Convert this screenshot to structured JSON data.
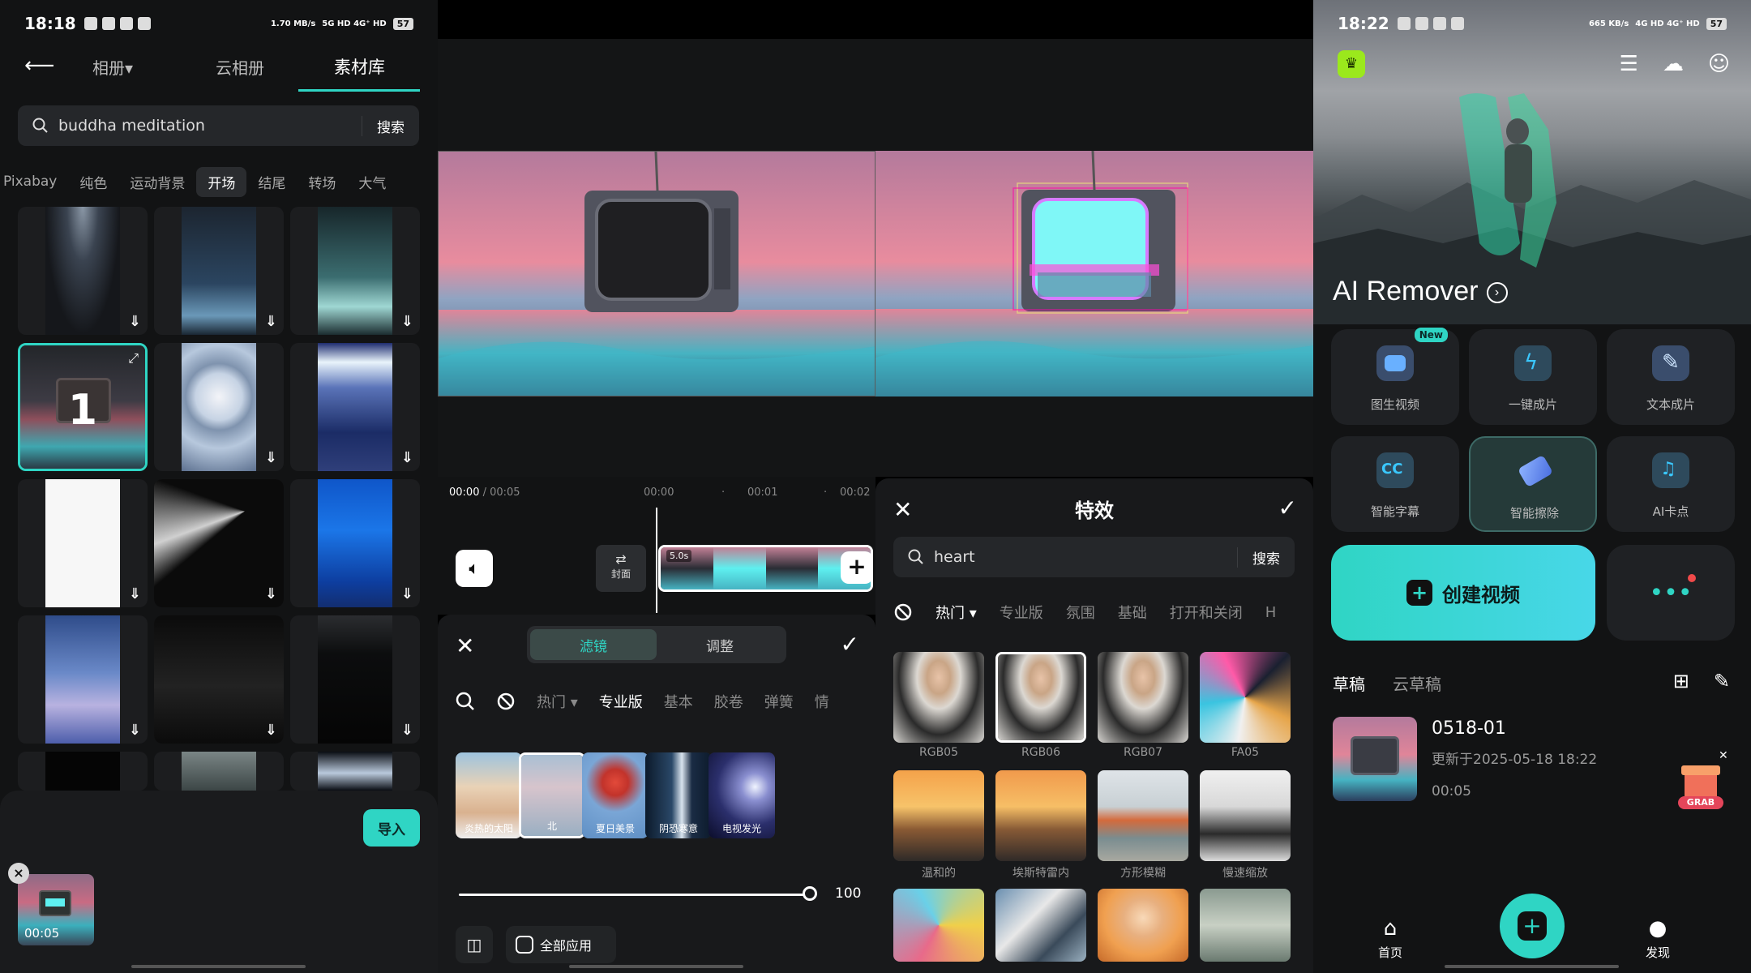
{
  "panel1": {
    "status": {
      "time": "18:18",
      "speed": "1.70 MB/s",
      "network": "5G HD 4G⁺ HD",
      "battery": "57"
    },
    "tabs": [
      "相册",
      "云相册",
      "素材库"
    ],
    "tab_album_suffix": "▾",
    "search": {
      "value": "buddha meditation",
      "button": "搜索"
    },
    "categories": [
      "Pixabay",
      "纯色",
      "运动背景",
      "开场",
      "结尾",
      "转场",
      "大气"
    ],
    "selected_index_label": "1",
    "import_button": "导入",
    "selected_clip_duration": "00:05"
  },
  "panel2": {
    "time_current": "00:00",
    "time_total": " / 00:05",
    "ticks": [
      "00:00",
      "00:01",
      "00:02"
    ],
    "cover_label": "封面",
    "clip_duration": "5.0s",
    "segments": [
      "滤镜",
      "调整"
    ],
    "filter_categories": [
      "热门 ▾",
      "专业版",
      "基本",
      "胶卷",
      "弹簧",
      "情"
    ],
    "filters": [
      "炎热的太阳",
      "北",
      "夏日美景",
      "阴恐寒意",
      "电视发光"
    ],
    "slider_value": "100",
    "apply_all": "全部应用"
  },
  "panel3": {
    "title": "特效",
    "search": {
      "value": "heart",
      "button": "搜索"
    },
    "categories": [
      "热门 ▾",
      "专业版",
      "氛围",
      "基础",
      "打开和关闭",
      "H"
    ],
    "effects": [
      "RGB05",
      "RGB06",
      "RGB07",
      "FA05",
      "温和的",
      "埃斯特雷内",
      "方形模糊",
      "慢速缩放"
    ]
  },
  "panel4": {
    "status": {
      "time": "18:22",
      "speed": "665 KB/s",
      "network": "4G HD 4G⁺ HD",
      "battery": "57"
    },
    "hero_title": "AI Remover",
    "tools": [
      "图生视频",
      "一键成片",
      "文本成片",
      "智能字幕",
      "智能擦除",
      "AI卡点"
    ],
    "new_badge": "New",
    "cc_text": "CC",
    "create_button": "创建视频",
    "draft_tabs": [
      "草稿",
      "云草稿"
    ],
    "draft": {
      "name": "0518-01",
      "updated": "更新于2025-05-18 18:22",
      "duration": "00:05"
    },
    "grab_label": "GRAB",
    "nav": [
      "首页",
      "发现"
    ]
  },
  "colors": {
    "accent": "#2fd5c4",
    "bg": "#121314",
    "sheet": "#18191b"
  }
}
